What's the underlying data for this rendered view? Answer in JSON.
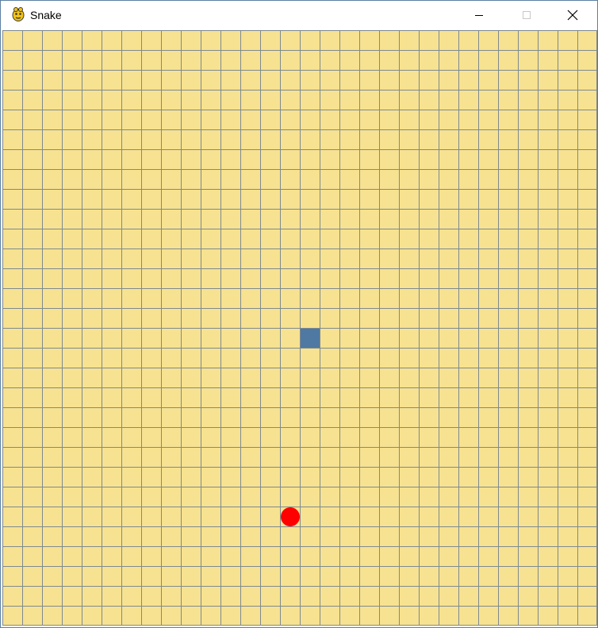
{
  "window": {
    "title": "Snake",
    "app_icon": "pygame-snake-icon",
    "controls": {
      "minimize_icon": "minimize-icon",
      "maximize_icon": "maximize-icon",
      "close_icon": "close-icon"
    }
  },
  "game": {
    "grid": {
      "columns": 30,
      "rows": 30
    },
    "colors": {
      "board": "#f7e291",
      "grid_lines": "#7e8a8f",
      "snake": "#4f79a3",
      "food": "#ff0000"
    },
    "snake": [
      {
        "col": 15,
        "row": 15
      }
    ],
    "food": {
      "col": 14,
      "row": 24
    }
  }
}
